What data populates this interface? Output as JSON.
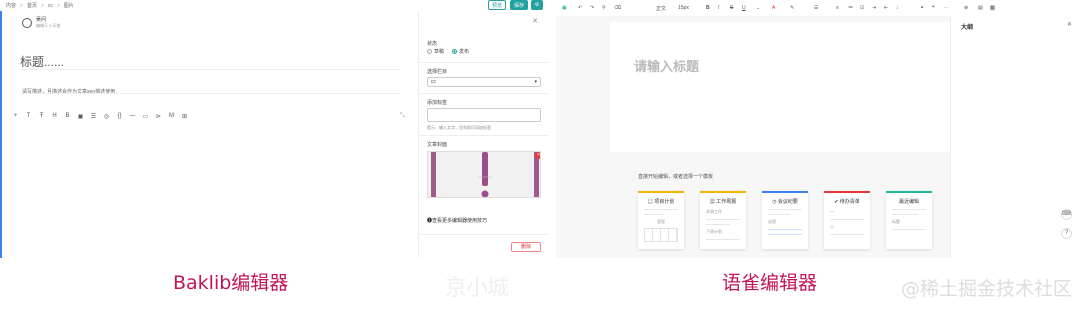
{
  "baklib": {
    "breadcrumb": [
      "内容",
      "首页",
      "cc",
      "图片"
    ],
    "preview_label": "预览",
    "save_label": "保存",
    "settings_label": "⚙",
    "author_name": "吴问",
    "author_sub": "编辑于 3 天前",
    "title_placeholder": "标题......",
    "desc_placeholder": "请写描述，且描述会作为文章seo描述使用",
    "toolbar_icons": [
      "+",
      "T",
      "Ŧ",
      "H",
      "B",
      "▣",
      "☰",
      "◎",
      "{}",
      "—",
      "▭",
      "⊳",
      "M",
      "⊞"
    ],
    "panel": {
      "status_label": "状态",
      "status_options": [
        "草稿",
        "发布"
      ],
      "status_selected": "发布",
      "column_label": "选择栏目",
      "column_value": "cc",
      "tags_label": "添加标签",
      "tags_hint": "提示：输入文字，回车即可添加标签",
      "cover_label": "文章封面",
      "tips_link": "❶查看更多编辑器使用技巧",
      "delete_label": "删除"
    },
    "caption": "Baklib编辑器"
  },
  "middle_caption": "京小城",
  "yuque": {
    "toolbar": {
      "style": "正文",
      "font_size": "15px",
      "bold": "B",
      "italic": "I",
      "strike": "S",
      "underline": "U"
    },
    "title_placeholder": "请输入标题",
    "start_hint": "直接开始编辑，或者选择一个模板",
    "templates": [
      {
        "icon": "📋",
        "title": "项目计划",
        "color": "#f4b400",
        "lines": [
          "里程"
        ]
      },
      {
        "icon": "📅",
        "title": "工作周报",
        "color": "#f4b400",
        "lines": [
          "本周工作",
          "下周计划"
        ]
      },
      {
        "icon": "🕘",
        "title": "会议纪要",
        "color": "#3b82f6",
        "lines": [
          "议程"
        ]
      },
      {
        "icon": "✔",
        "title": "待办清单",
        "color": "#e53935",
        "lines": [
          "一",
          "二"
        ]
      },
      {
        "icon": "",
        "title": "最近编辑",
        "color": "#22b59a",
        "lines": [
          "标题"
        ]
      }
    ],
    "outline_title": "大纲",
    "caption": "语雀编辑器"
  },
  "watermark": "@稀土掘金技术社区"
}
